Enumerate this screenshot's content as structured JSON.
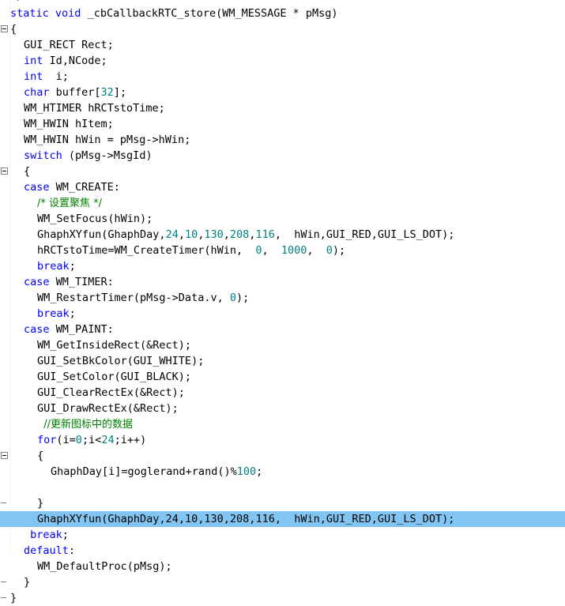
{
  "editor": {
    "app": "code-editor",
    "language": "c",
    "colors": {
      "background": "#ffffff",
      "text": "#000000",
      "keyword": "#0000ff",
      "number": "#008080",
      "comment": "#008000",
      "selection": "#82c4f2",
      "gutter": "#ffffff",
      "fold_marker": "#808080"
    },
    "selected_line_index": 29,
    "top_partial_line": "*/",
    "lines": [
      {
        "indent": 0,
        "fold": null,
        "tokens": [
          {
            "t": "static",
            "c": "kw"
          },
          {
            "t": " ",
            "c": "plain"
          },
          {
            "t": "void",
            "c": "kw"
          },
          {
            "t": " _cbCallbackRTC_store(WM_MESSAGE * pMsg)",
            "c": "plain"
          }
        ]
      },
      {
        "indent": 0,
        "fold": "open",
        "tokens": [
          {
            "t": "{",
            "c": "plain"
          }
        ]
      },
      {
        "indent": 1,
        "fold": null,
        "tokens": [
          {
            "t": "GUI_RECT Rect;",
            "c": "plain"
          }
        ]
      },
      {
        "indent": 1,
        "fold": null,
        "tokens": [
          {
            "t": "int",
            "c": "kw"
          },
          {
            "t": " Id,NCode;",
            "c": "plain"
          }
        ]
      },
      {
        "indent": 1,
        "fold": null,
        "tokens": [
          {
            "t": "int",
            "c": "kw"
          },
          {
            "t": "  i;",
            "c": "plain"
          }
        ]
      },
      {
        "indent": 1,
        "fold": null,
        "tokens": [
          {
            "t": "char",
            "c": "kw"
          },
          {
            "t": " buffer[",
            "c": "plain"
          },
          {
            "t": "32",
            "c": "num"
          },
          {
            "t": "];",
            "c": "plain"
          }
        ]
      },
      {
        "indent": 1,
        "fold": null,
        "tokens": [
          {
            "t": "WM_HTIMER hRCTstoTime;",
            "c": "plain"
          }
        ]
      },
      {
        "indent": 1,
        "fold": null,
        "tokens": [
          {
            "t": "WM_HWIN hItem;",
            "c": "plain"
          }
        ]
      },
      {
        "indent": 1,
        "fold": null,
        "tokens": [
          {
            "t": "WM_HWIN hWin = pMsg->hWin;",
            "c": "plain"
          }
        ]
      },
      {
        "indent": 1,
        "fold": null,
        "tokens": [
          {
            "t": "switch",
            "c": "kw"
          },
          {
            "t": " (pMsg->MsgId)",
            "c": "plain"
          }
        ]
      },
      {
        "indent": 1,
        "fold": "open",
        "tokens": [
          {
            "t": "{",
            "c": "plain"
          }
        ]
      },
      {
        "indent": 1,
        "fold": null,
        "tokens": [
          {
            "t": "case",
            "c": "kw"
          },
          {
            "t": " WM_CREATE:",
            "c": "plain"
          }
        ]
      },
      {
        "indent": 2,
        "fold": null,
        "tokens": [
          {
            "t": "/* 设置聚焦 */",
            "c": "cmt"
          }
        ]
      },
      {
        "indent": 2,
        "fold": null,
        "tokens": [
          {
            "t": "WM_SetFocus(hWin);",
            "c": "plain"
          }
        ]
      },
      {
        "indent": 2,
        "fold": null,
        "tokens": [
          {
            "t": "GhaphXYfun(GhaphDay,",
            "c": "plain"
          },
          {
            "t": "24",
            "c": "num"
          },
          {
            "t": ",",
            "c": "plain"
          },
          {
            "t": "10",
            "c": "num"
          },
          {
            "t": ",",
            "c": "plain"
          },
          {
            "t": "130",
            "c": "num"
          },
          {
            "t": ",",
            "c": "plain"
          },
          {
            "t": "208",
            "c": "num"
          },
          {
            "t": ",",
            "c": "plain"
          },
          {
            "t": "116",
            "c": "num"
          },
          {
            "t": ",  hWin,GUI_RED,GUI_LS_DOT);",
            "c": "plain"
          }
        ]
      },
      {
        "indent": 2,
        "fold": null,
        "tokens": [
          {
            "t": "hRCTstoTime=WM_CreateTimer(hWin,  ",
            "c": "plain"
          },
          {
            "t": "0",
            "c": "num"
          },
          {
            "t": ",  ",
            "c": "plain"
          },
          {
            "t": "1000",
            "c": "num"
          },
          {
            "t": ",  ",
            "c": "plain"
          },
          {
            "t": "0",
            "c": "num"
          },
          {
            "t": ");",
            "c": "plain"
          }
        ]
      },
      {
        "indent": 2,
        "fold": null,
        "tokens": [
          {
            "t": "break",
            "c": "kw"
          },
          {
            "t": ";",
            "c": "plain"
          }
        ]
      },
      {
        "indent": 1,
        "fold": null,
        "tokens": [
          {
            "t": "case",
            "c": "kw"
          },
          {
            "t": " WM_TIMER:",
            "c": "plain"
          }
        ]
      },
      {
        "indent": 2,
        "fold": null,
        "tokens": [
          {
            "t": "WM_RestartTimer(pMsg->Data.v, ",
            "c": "plain"
          },
          {
            "t": "0",
            "c": "num"
          },
          {
            "t": ");",
            "c": "plain"
          }
        ]
      },
      {
        "indent": 2,
        "fold": null,
        "tokens": [
          {
            "t": "break",
            "c": "kw"
          },
          {
            "t": ";",
            "c": "plain"
          }
        ]
      },
      {
        "indent": 1,
        "fold": null,
        "tokens": [
          {
            "t": "case",
            "c": "kw"
          },
          {
            "t": " WM_PAINT:",
            "c": "plain"
          }
        ]
      },
      {
        "indent": 2,
        "fold": null,
        "tokens": [
          {
            "t": "WM_GetInsideRect(&Rect);",
            "c": "plain"
          }
        ]
      },
      {
        "indent": 2,
        "fold": null,
        "tokens": [
          {
            "t": "GUI_SetBkColor(GUI_WHITE);",
            "c": "plain"
          }
        ]
      },
      {
        "indent": 2,
        "fold": null,
        "tokens": [
          {
            "t": "GUI_SetColor(GUI_BLACK);",
            "c": "plain"
          }
        ]
      },
      {
        "indent": 2,
        "fold": null,
        "tokens": [
          {
            "t": "GUI_ClearRectEx(&Rect);",
            "c": "plain"
          }
        ]
      },
      {
        "indent": 2,
        "fold": null,
        "tokens": [
          {
            "t": "GUI_DrawRectEx(&Rect);",
            "c": "plain"
          }
        ]
      },
      {
        "indent": 2,
        "fold": null,
        "tokens": [
          {
            "t": "  //更新图标中的数据",
            "c": "cmt"
          }
        ]
      },
      {
        "indent": 2,
        "fold": null,
        "tokens": [
          {
            "t": "for",
            "c": "kw"
          },
          {
            "t": "(i=",
            "c": "plain"
          },
          {
            "t": "0",
            "c": "num"
          },
          {
            "t": ";i<",
            "c": "plain"
          },
          {
            "t": "24",
            "c": "num"
          },
          {
            "t": ";i++)",
            "c": "plain"
          }
        ]
      },
      {
        "indent": 2,
        "fold": "open",
        "tokens": [
          {
            "t": "{",
            "c": "plain"
          }
        ]
      },
      {
        "indent": 3,
        "fold": null,
        "tokens": [
          {
            "t": "GhaphDay[i]=goglerand+rand()%",
            "c": "plain"
          },
          {
            "t": "100",
            "c": "num"
          },
          {
            "t": ";",
            "c": "plain"
          }
        ]
      },
      {
        "indent": 0,
        "fold": null,
        "tokens": [
          {
            "t": "",
            "c": "plain"
          }
        ]
      },
      {
        "indent": 2,
        "fold": "close",
        "tokens": [
          {
            "t": "}",
            "c": "plain"
          }
        ]
      },
      {
        "indent": 2,
        "fold": null,
        "selected": true,
        "tokens": [
          {
            "t": "GhaphXYfun(GhaphDay,",
            "c": "plain"
          },
          {
            "t": "24",
            "c": "num"
          },
          {
            "t": ",",
            "c": "plain"
          },
          {
            "t": "10",
            "c": "num"
          },
          {
            "t": ",",
            "c": "plain"
          },
          {
            "t": "130",
            "c": "num"
          },
          {
            "t": ",",
            "c": "plain"
          },
          {
            "t": "208",
            "c": "num"
          },
          {
            "t": ",",
            "c": "plain"
          },
          {
            "t": "116",
            "c": "num"
          },
          {
            "t": ",  hWin,GUI_RED,GUI_LS_DOT);",
            "c": "plain"
          }
        ]
      },
      {
        "indent": 1,
        "fold": null,
        "tokens": [
          {
            "t": " break",
            "c": "kw"
          },
          {
            "t": ";",
            "c": "plain"
          }
        ]
      },
      {
        "indent": 1,
        "fold": null,
        "tokens": [
          {
            "t": "default",
            "c": "kw"
          },
          {
            "t": ":",
            "c": "plain"
          }
        ]
      },
      {
        "indent": 2,
        "fold": null,
        "tokens": [
          {
            "t": "WM_DefaultProc(pMsg);",
            "c": "plain"
          }
        ]
      },
      {
        "indent": 1,
        "fold": "close",
        "tokens": [
          {
            "t": "}",
            "c": "plain"
          }
        ]
      },
      {
        "indent": 0,
        "fold": "close",
        "tokens": [
          {
            "t": "}",
            "c": "plain"
          }
        ]
      }
    ]
  }
}
